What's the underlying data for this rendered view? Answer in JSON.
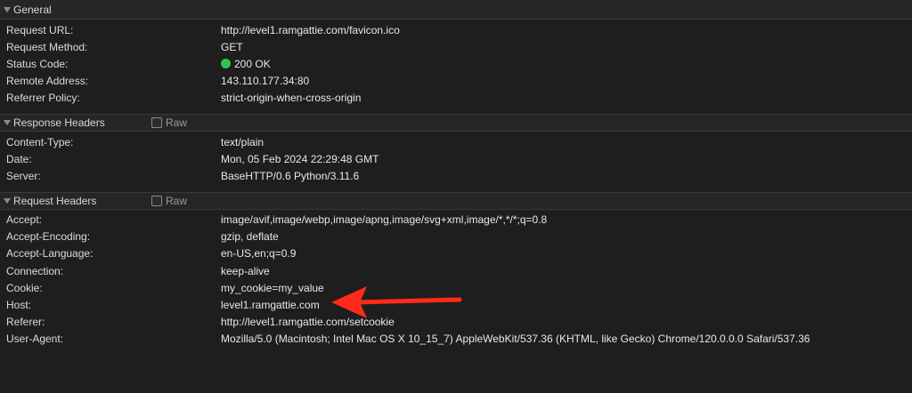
{
  "general": {
    "title": "General",
    "rows": [
      {
        "key": "Request URL:",
        "value": "http://level1.ramgattie.com/favicon.ico"
      },
      {
        "key": "Request Method:",
        "value": "GET"
      },
      {
        "key": "Status Code:",
        "value": "200 OK"
      },
      {
        "key": "Remote Address:",
        "value": "143.110.177.34:80"
      },
      {
        "key": "Referrer Policy:",
        "value": "strict-origin-when-cross-origin"
      }
    ],
    "status_color": "#30c552"
  },
  "response": {
    "title": "Response Headers",
    "raw_label": "Raw",
    "rows": [
      {
        "key": "Content-Type:",
        "value": "text/plain"
      },
      {
        "key": "Date:",
        "value": "Mon, 05 Feb 2024 22:29:48 GMT"
      },
      {
        "key": "Server:",
        "value": "BaseHTTP/0.6 Python/3.11.6"
      }
    ]
  },
  "request": {
    "title": "Request Headers",
    "raw_label": "Raw",
    "rows": [
      {
        "key": "Accept:",
        "value": "image/avif,image/webp,image/apng,image/svg+xml,image/*,*/*;q=0.8"
      },
      {
        "key": "Accept-Encoding:",
        "value": "gzip, deflate"
      },
      {
        "key": "Accept-Language:",
        "value": "en-US,en;q=0.9"
      },
      {
        "key": "Connection:",
        "value": "keep-alive"
      },
      {
        "key": "Cookie:",
        "value": "my_cookie=my_value"
      },
      {
        "key": "Host:",
        "value": "level1.ramgattie.com"
      },
      {
        "key": "Referer:",
        "value": "http://level1.ramgattie.com/setcookie"
      },
      {
        "key": "User-Agent:",
        "value": "Mozilla/5.0 (Macintosh; Intel Mac OS X 10_15_7) AppleWebKit/537.36 (KHTML, like Gecko) Chrome/120.0.0.0 Safari/537.36"
      }
    ]
  },
  "annotation": {
    "arrow_color": "#ff2a1a",
    "icon": "red-arrow-icon"
  }
}
